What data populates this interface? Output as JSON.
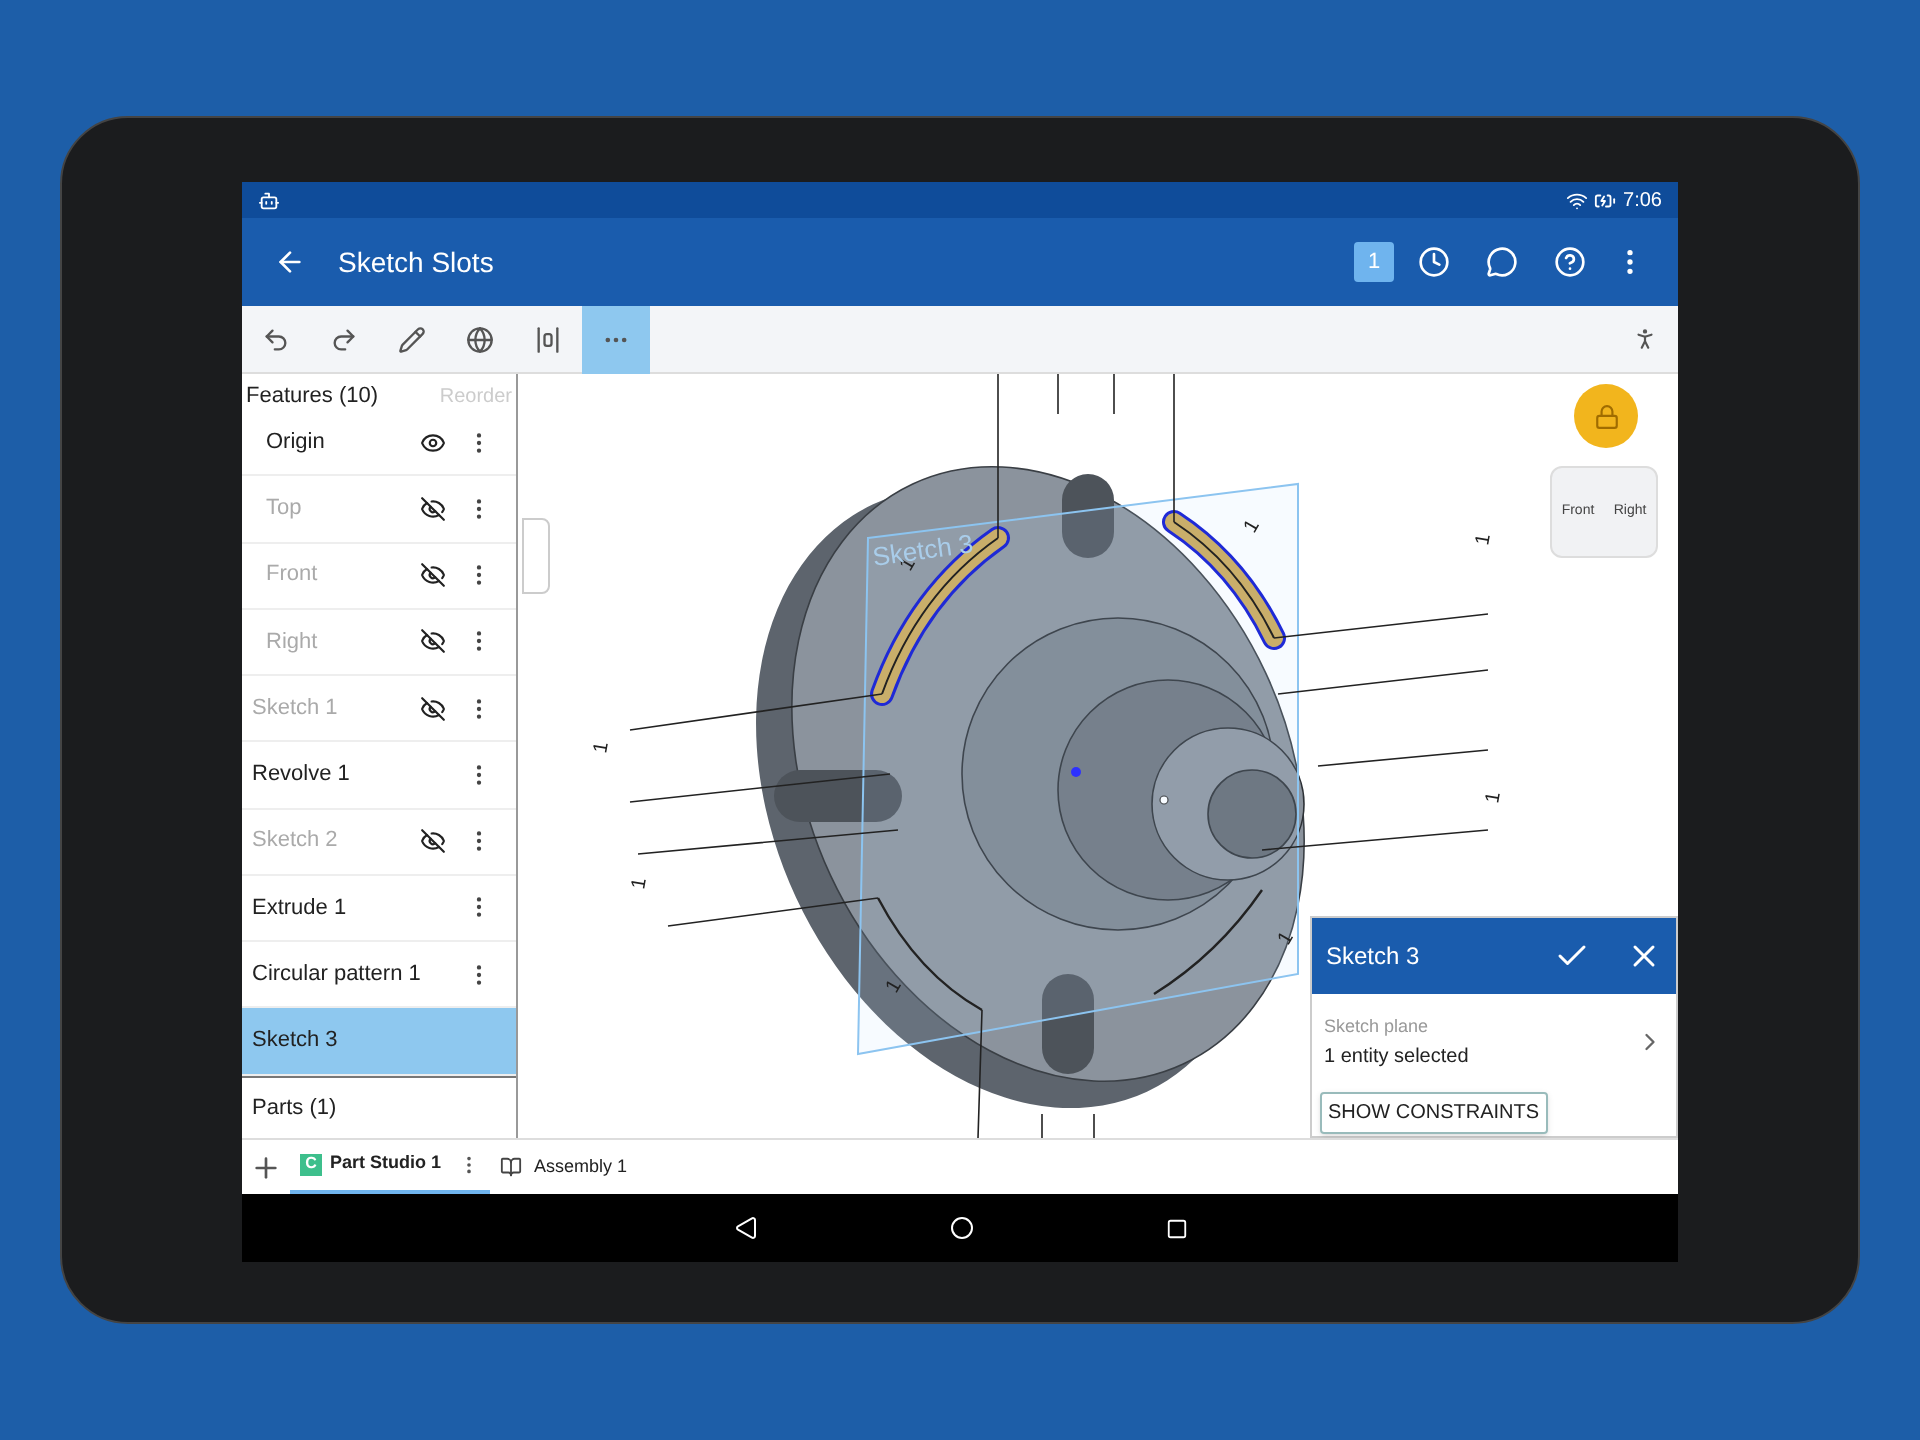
{
  "status_bar": {
    "time": "7:06"
  },
  "app_bar": {
    "title": "Sketch Slots",
    "badge": "1"
  },
  "toolbar": [
    {
      "selected": false
    },
    {
      "selected": false
    },
    {
      "selected": false
    },
    {
      "selected": false
    },
    {
      "selected": false
    },
    {
      "selected": true
    }
  ],
  "features_panel": {
    "title": "Features (10)",
    "reorder": "Reorder",
    "items": [
      {
        "name": "Origin",
        "kind": "default-geometry",
        "dimmed": false,
        "visibility_toggle": true,
        "visible": true,
        "selected": false
      },
      {
        "name": "Top",
        "kind": "default-geometry",
        "dimmed": true,
        "visibility_toggle": true,
        "visible": false,
        "selected": false
      },
      {
        "name": "Front",
        "kind": "default-geometry",
        "dimmed": true,
        "visibility_toggle": true,
        "visible": false,
        "selected": false
      },
      {
        "name": "Right",
        "kind": "default-geometry",
        "dimmed": true,
        "visibility_toggle": true,
        "visible": false,
        "selected": false
      },
      {
        "name": "Sketch 1",
        "kind": "feature",
        "dimmed": true,
        "visibility_toggle": true,
        "visible": false,
        "selected": false
      },
      {
        "name": "Revolve 1",
        "kind": "feature",
        "dimmed": false,
        "visibility_toggle": false,
        "selected": false
      },
      {
        "name": "Sketch 2",
        "kind": "feature",
        "dimmed": true,
        "visibility_toggle": true,
        "visible": false,
        "selected": false
      },
      {
        "name": "Extrude 1",
        "kind": "feature",
        "dimmed": false,
        "visibility_toggle": false,
        "selected": false
      },
      {
        "name": "Circular pattern 1",
        "kind": "feature",
        "dimmed": false,
        "visibility_toggle": false,
        "selected": false
      },
      {
        "name": "Sketch 3",
        "kind": "sketch",
        "dimmed": false,
        "visibility_toggle": false,
        "selected": true
      }
    ],
    "parts": "Parts (1)"
  },
  "viewport": {
    "sketch_label": "Sketch 3",
    "dimension_labels": [
      "1",
      "1",
      "1",
      "1",
      "1",
      "1",
      "1",
      "1"
    ],
    "view_cube": {
      "front": "Front",
      "right": "Right"
    }
  },
  "sketch_dialog": {
    "title": "Sketch 3",
    "field_label": "Sketch plane",
    "field_value": "1 entity selected",
    "button": "SHOW CONSTRAINTS"
  },
  "tabs": [
    {
      "icon_letter": "C",
      "label": "Part Studio 1",
      "selected": true
    },
    {
      "label": "Assembly 1",
      "selected": false
    }
  ]
}
